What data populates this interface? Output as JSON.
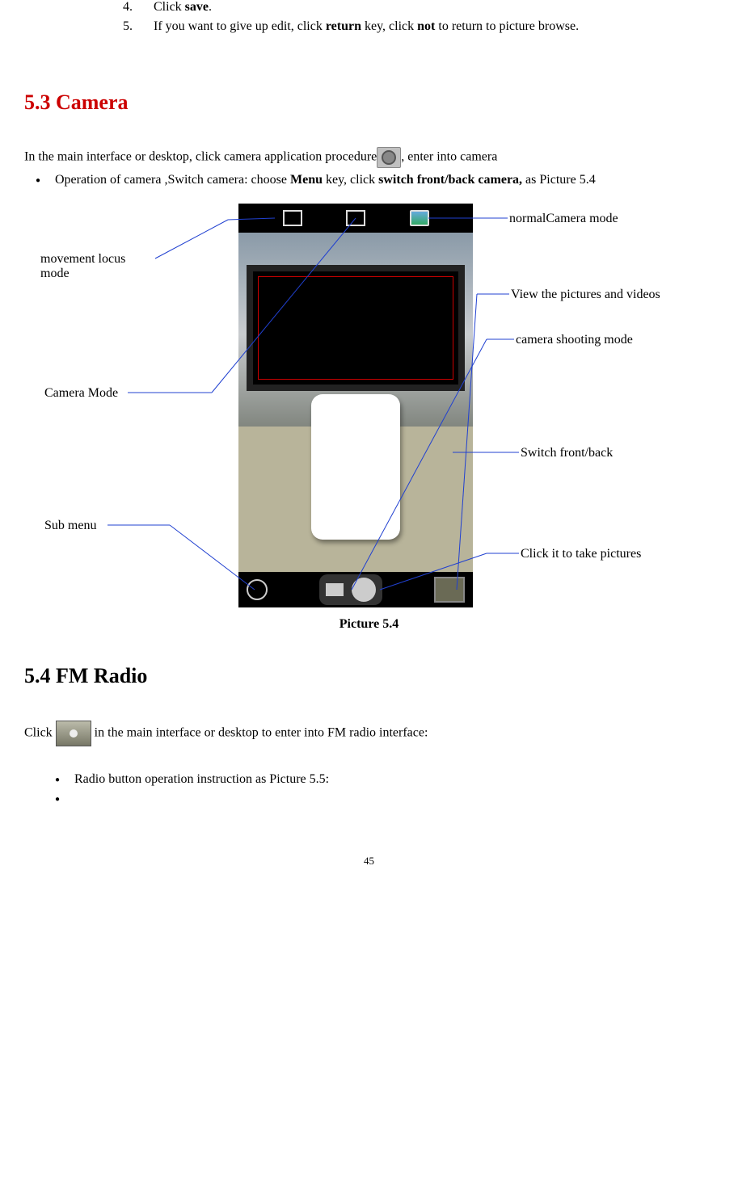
{
  "list": {
    "item4_pre": "Click ",
    "item4_bold": "save",
    "item4_post": ".",
    "item5_pre": "If you want to give up edit, click ",
    "item5_b1": "return",
    "item5_mid1": " key, click ",
    "item5_b2": "not",
    "item5_mid2": " to return to picture browse."
  },
  "section_camera": "5.3 Camera",
  "camera_intro_pre": "In the main interface or desktop, click camera application procedure",
  "camera_intro_post": ",  enter into camera",
  "camera_bullet_pre": "Operation of camera ,Switch camera: choose ",
  "camera_bullet_b1": "Menu",
  "camera_bullet_mid": " key, click ",
  "camera_bullet_b2": "switch front/back camera,",
  "camera_bullet_post": " as Picture 5.4",
  "callouts": {
    "movement": "movement locus mode",
    "camera_mode": "Camera Mode",
    "sub_menu": "Sub menu",
    "normal": "normalCamera mode",
    "view": "View the pictures and videos",
    "shooting": "camera shooting mode",
    "switch": "Switch  front/back",
    "take": "Click it to take pictures"
  },
  "fig_caption": "Picture 5.4",
  "section_fm": "5.4 FM Radio",
  "fm_intro_pre": "Click  ",
  "fm_intro_post": "  in the main interface or desktop to enter into FM radio interface:",
  "fm_bullet1": "Radio button operation instruction as Picture 5.5:",
  "page_number": "45"
}
